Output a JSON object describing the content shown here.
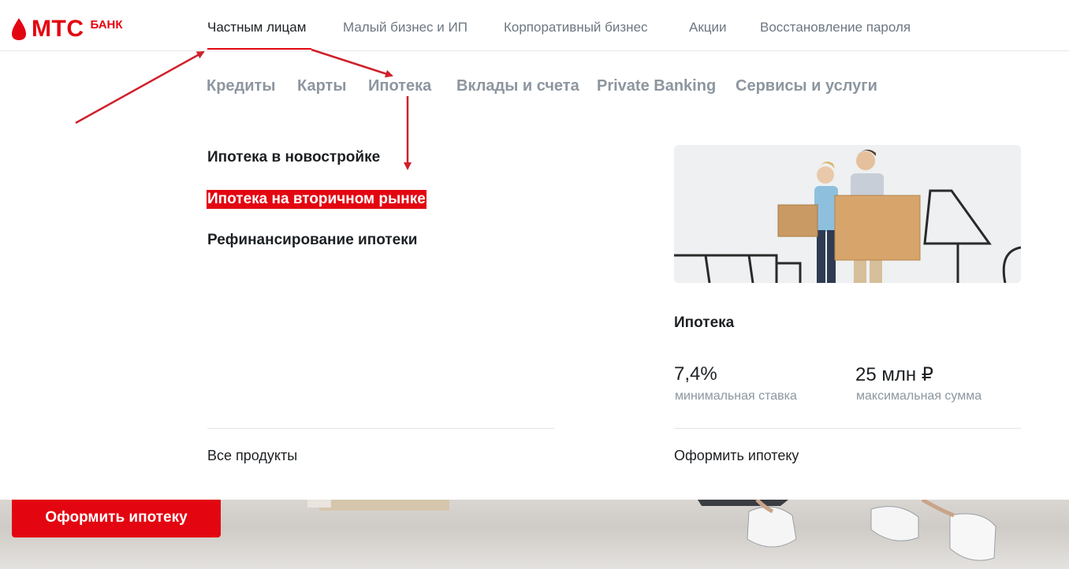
{
  "brand": {
    "name": "МТС",
    "suffix": "БАНК",
    "color": "#e30611"
  },
  "top_nav": [
    {
      "label": "Частным лицам",
      "active": true
    },
    {
      "label": "Малый бизнес и ИП"
    },
    {
      "label": "Корпоративный бизнес"
    },
    {
      "label": "Акции"
    },
    {
      "label": "Восстановление пароля"
    }
  ],
  "sub_nav": [
    {
      "label": "Кредиты"
    },
    {
      "label": "Карты"
    },
    {
      "label": "Ипотека"
    },
    {
      "label": "Вклады и счета"
    },
    {
      "label": "Private Banking"
    },
    {
      "label": "Сервисы и услуги"
    }
  ],
  "menu": {
    "items": [
      {
        "label": "Ипотека в новостройке"
      },
      {
        "label": "Ипотека на вторичном рынке",
        "highlighted": true
      },
      {
        "label": "Рефинансирование ипотеки"
      }
    ],
    "all_products": "Все продукты"
  },
  "promo": {
    "title": "Ипотека",
    "stats": [
      {
        "value": "7,4%",
        "caption": "минимальная ставка"
      },
      {
        "value": "25 млн ₽",
        "caption": "максимальная сумма"
      }
    ],
    "cta": "Оформить ипотеку"
  },
  "hero": {
    "button_label": "Оформить ипотеку"
  },
  "colors": {
    "accent": "#e30611",
    "text": "#1d2023",
    "muted": "#8d969f",
    "annotation": "#d0202b"
  }
}
